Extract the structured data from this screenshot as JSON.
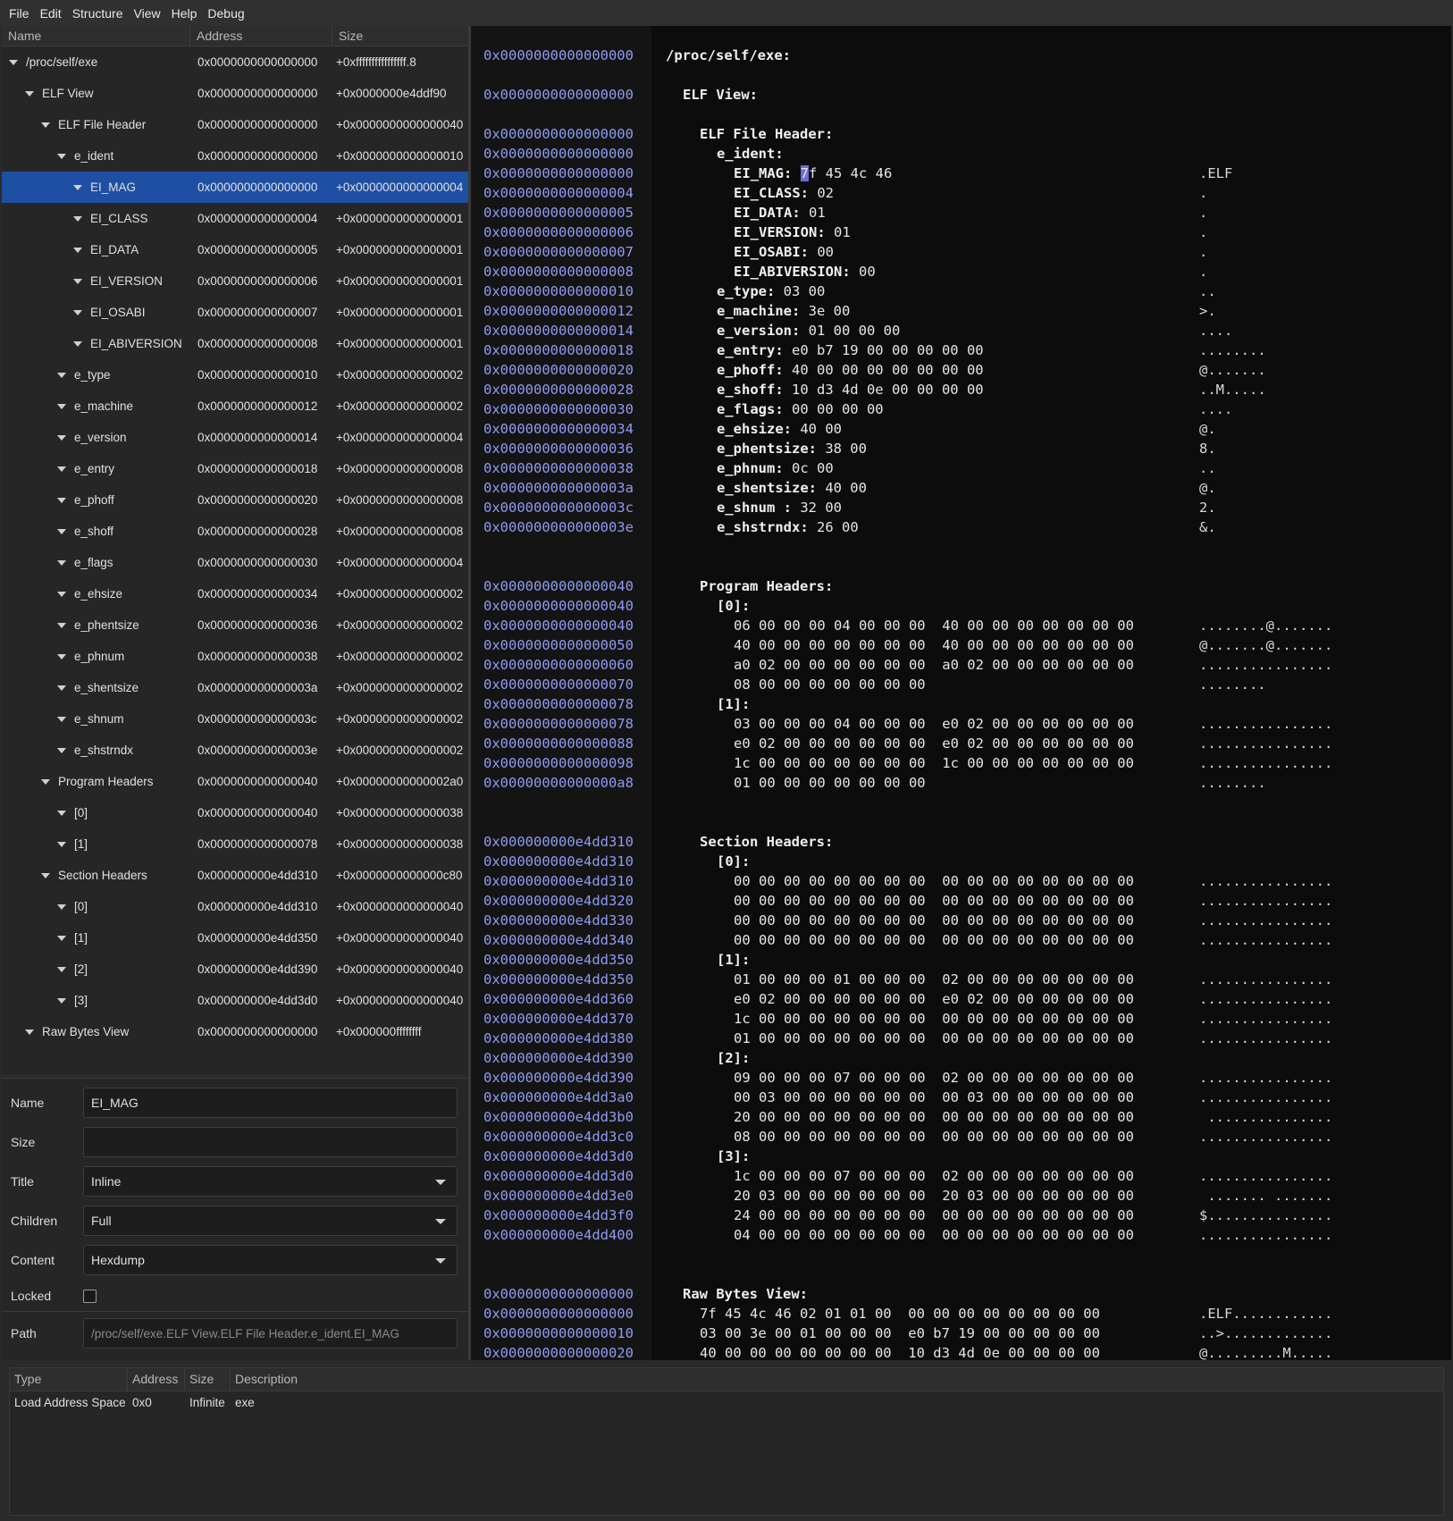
{
  "menu": [
    "File",
    "Edit",
    "Structure",
    "View",
    "Help",
    "Debug"
  ],
  "tree": {
    "columns": [
      "Name",
      "Address",
      "Size"
    ],
    "rows": [
      {
        "name": "/proc/self/exe",
        "addr": "0x0000000000000000",
        "size": "+0xffffffffffffffff.8",
        "level": 0
      },
      {
        "name": "ELF View",
        "addr": "0x0000000000000000",
        "size": "+0x0000000e4ddf90",
        "level": 1
      },
      {
        "name": "ELF File Header",
        "addr": "0x0000000000000000",
        "size": "+0x0000000000000040",
        "level": 2
      },
      {
        "name": "e_ident",
        "addr": "0x0000000000000000",
        "size": "+0x0000000000000010",
        "level": 3
      },
      {
        "name": "EI_MAG",
        "addr": "0x0000000000000000",
        "size": "+0x0000000000000004",
        "level": 4,
        "selected": true
      },
      {
        "name": "EI_CLASS",
        "addr": "0x0000000000000004",
        "size": "+0x0000000000000001",
        "level": 4
      },
      {
        "name": "EI_DATA",
        "addr": "0x0000000000000005",
        "size": "+0x0000000000000001",
        "level": 4
      },
      {
        "name": "EI_VERSION",
        "addr": "0x0000000000000006",
        "size": "+0x0000000000000001",
        "level": 4
      },
      {
        "name": "EI_OSABI",
        "addr": "0x0000000000000007",
        "size": "+0x0000000000000001",
        "level": 4
      },
      {
        "name": "EI_ABIVERSION",
        "addr": "0x0000000000000008",
        "size": "+0x0000000000000001",
        "level": 4
      },
      {
        "name": "e_type",
        "addr": "0x0000000000000010",
        "size": "+0x0000000000000002",
        "level": 3
      },
      {
        "name": "e_machine",
        "addr": "0x0000000000000012",
        "size": "+0x0000000000000002",
        "level": 3
      },
      {
        "name": "e_version",
        "addr": "0x0000000000000014",
        "size": "+0x0000000000000004",
        "level": 3
      },
      {
        "name": "e_entry",
        "addr": "0x0000000000000018",
        "size": "+0x0000000000000008",
        "level": 3
      },
      {
        "name": "e_phoff",
        "addr": "0x0000000000000020",
        "size": "+0x0000000000000008",
        "level": 3
      },
      {
        "name": "e_shoff",
        "addr": "0x0000000000000028",
        "size": "+0x0000000000000008",
        "level": 3
      },
      {
        "name": "e_flags",
        "addr": "0x0000000000000030",
        "size": "+0x0000000000000004",
        "level": 3
      },
      {
        "name": "e_ehsize",
        "addr": "0x0000000000000034",
        "size": "+0x0000000000000002",
        "level": 3
      },
      {
        "name": "e_phentsize",
        "addr": "0x0000000000000036",
        "size": "+0x0000000000000002",
        "level": 3
      },
      {
        "name": "e_phnum",
        "addr": "0x0000000000000038",
        "size": "+0x0000000000000002",
        "level": 3
      },
      {
        "name": "e_shentsize",
        "addr": "0x000000000000003a",
        "size": "+0x0000000000000002",
        "level": 3
      },
      {
        "name": "e_shnum",
        "addr": "0x000000000000003c",
        "size": "+0x0000000000000002",
        "level": 3
      },
      {
        "name": "e_shstrndx",
        "addr": "0x000000000000003e",
        "size": "+0x0000000000000002",
        "level": 3
      },
      {
        "name": "Program Headers",
        "addr": "0x0000000000000040",
        "size": "+0x00000000000002a0",
        "level": 2
      },
      {
        "name": "[0]",
        "addr": "0x0000000000000040",
        "size": "+0x0000000000000038",
        "level": 3
      },
      {
        "name": "[1]",
        "addr": "0x0000000000000078",
        "size": "+0x0000000000000038",
        "level": 3
      },
      {
        "name": "Section Headers",
        "addr": "0x000000000e4dd310",
        "size": "+0x0000000000000c80",
        "level": 2
      },
      {
        "name": "[0]",
        "addr": "0x000000000e4dd310",
        "size": "+0x0000000000000040",
        "level": 3
      },
      {
        "name": "[1]",
        "addr": "0x000000000e4dd350",
        "size": "+0x0000000000000040",
        "level": 3
      },
      {
        "name": "[2]",
        "addr": "0x000000000e4dd390",
        "size": "+0x0000000000000040",
        "level": 3
      },
      {
        "name": "[3]",
        "addr": "0x000000000e4dd3d0",
        "size": "+0x0000000000000040",
        "level": 3
      },
      {
        "name": "Raw Bytes View",
        "addr": "0x0000000000000000",
        "size": "+0x000000ffffffff",
        "level": 1
      }
    ]
  },
  "props": {
    "name_label": "Name",
    "name_value": "EI_MAG",
    "size_label": "Size",
    "size_value": "",
    "title_label": "Title",
    "title_value": "Inline",
    "children_label": "Children",
    "children_value": "Full",
    "content_label": "Content",
    "content_value": "Hexdump",
    "locked_label": "Locked",
    "locked": false,
    "path_label": "Path",
    "path_value": "/proc/self/exe.ELF View.ELF File Header.e_ident.EI_MAG"
  },
  "hex": {
    "cursor_char": "7",
    "lines": [
      {
        "row": 0,
        "addr": "0x0000000000000000",
        "key": "/proc/self/exe:",
        "indent": 0
      },
      {
        "row": 2,
        "addr": "0x0000000000000000",
        "key": "ELF View:",
        "indent": 1
      },
      {
        "row": 4,
        "addr": "0x0000000000000000",
        "key": "ELF File Header:",
        "indent": 2
      },
      {
        "row": 5,
        "addr": "0x0000000000000000",
        "key": "e_ident:",
        "indent": 3
      },
      {
        "row": 6,
        "addr": "0x0000000000000000",
        "key": "EI_MAG:",
        "indent": 4,
        "val": "f 45 4c 46",
        "ascii": ".ELF",
        "cursor": true
      },
      {
        "row": 7,
        "addr": "0x0000000000000004",
        "key": "EI_CLASS:",
        "indent": 4,
        "val": " 02",
        "ascii": "."
      },
      {
        "row": 8,
        "addr": "0x0000000000000005",
        "key": "EI_DATA:",
        "indent": 4,
        "val": " 01",
        "ascii": "."
      },
      {
        "row": 9,
        "addr": "0x0000000000000006",
        "key": "EI_VERSION:",
        "indent": 4,
        "val": " 01",
        "ascii": "."
      },
      {
        "row": 10,
        "addr": "0x0000000000000007",
        "key": "EI_OSABI:",
        "indent": 4,
        "val": " 00",
        "ascii": "."
      },
      {
        "row": 11,
        "addr": "0x0000000000000008",
        "key": "EI_ABIVERSION:",
        "indent": 4,
        "val": " 00",
        "ascii": "."
      },
      {
        "row": 12,
        "addr": "0x0000000000000010",
        "key": "e_type:",
        "indent": 3,
        "val": " 03 00",
        "ascii": ".."
      },
      {
        "row": 13,
        "addr": "0x0000000000000012",
        "key": "e_machine:",
        "indent": 3,
        "val": " 3e 00",
        "ascii": ">."
      },
      {
        "row": 14,
        "addr": "0x0000000000000014",
        "key": "e_version:",
        "indent": 3,
        "val": " 01 00 00 00",
        "ascii": "...."
      },
      {
        "row": 15,
        "addr": "0x0000000000000018",
        "key": "e_entry:",
        "indent": 3,
        "val": " e0 b7 19 00 00 00 00 00",
        "ascii": "........"
      },
      {
        "row": 16,
        "addr": "0x0000000000000020",
        "key": "e_phoff:",
        "indent": 3,
        "val": " 40 00 00 00 00 00 00 00",
        "ascii": "@......."
      },
      {
        "row": 17,
        "addr": "0x0000000000000028",
        "key": "e_shoff:",
        "indent": 3,
        "val": " 10 d3 4d 0e 00 00 00 00",
        "ascii": "..M....."
      },
      {
        "row": 18,
        "addr": "0x0000000000000030",
        "key": "e_flags:",
        "indent": 3,
        "val": " 00 00 00 00",
        "ascii": "...."
      },
      {
        "row": 19,
        "addr": "0x0000000000000034",
        "key": "e_ehsize:",
        "indent": 3,
        "val": " 40 00",
        "ascii": "@."
      },
      {
        "row": 20,
        "addr": "0x0000000000000036",
        "key": "e_phentsize:",
        "indent": 3,
        "val": " 38 00",
        "ascii": "8."
      },
      {
        "row": 21,
        "addr": "0x0000000000000038",
        "key": "e_phnum:",
        "indent": 3,
        "val": " 0c 00",
        "ascii": ".."
      },
      {
        "row": 22,
        "addr": "0x000000000000003a",
        "key": "e_shentsize:",
        "indent": 3,
        "val": " 40 00",
        "ascii": "@."
      },
      {
        "row": 23,
        "addr": "0x000000000000003c",
        "key": "e_shnum :",
        "indent": 3,
        "val": " 32 00",
        "ascii": "2."
      },
      {
        "row": 24,
        "addr": "0x000000000000003e",
        "key": "e_shstrndx:",
        "indent": 3,
        "val": " 26 00",
        "ascii": "&."
      },
      {
        "row": 27,
        "addr": "0x0000000000000040",
        "key": "Program Headers:",
        "indent": 2
      },
      {
        "row": 28,
        "addr": "0x0000000000000040",
        "key": "[0]:",
        "indent": 3
      },
      {
        "row": 29,
        "addr": "0x0000000000000040",
        "indent": 4,
        "val": "06 00 00 00 04 00 00 00  40 00 00 00 00 00 00 00",
        "ascii": "........@......."
      },
      {
        "row": 30,
        "addr": "0x0000000000000050",
        "indent": 4,
        "val": "40 00 00 00 00 00 00 00  40 00 00 00 00 00 00 00",
        "ascii": "@.......@......."
      },
      {
        "row": 31,
        "addr": "0x0000000000000060",
        "indent": 4,
        "val": "a0 02 00 00 00 00 00 00  a0 02 00 00 00 00 00 00",
        "ascii": "................"
      },
      {
        "row": 32,
        "addr": "0x0000000000000070",
        "indent": 4,
        "val": "08 00 00 00 00 00 00 00",
        "ascii": "........"
      },
      {
        "row": 33,
        "addr": "0x0000000000000078",
        "key": "[1]:",
        "indent": 3
      },
      {
        "row": 34,
        "addr": "0x0000000000000078",
        "indent": 4,
        "val": "03 00 00 00 04 00 00 00  e0 02 00 00 00 00 00 00",
        "ascii": "................"
      },
      {
        "row": 35,
        "addr": "0x0000000000000088",
        "indent": 4,
        "val": "e0 02 00 00 00 00 00 00  e0 02 00 00 00 00 00 00",
        "ascii": "................"
      },
      {
        "row": 36,
        "addr": "0x0000000000000098",
        "indent": 4,
        "val": "1c 00 00 00 00 00 00 00  1c 00 00 00 00 00 00 00",
        "ascii": "................"
      },
      {
        "row": 37,
        "addr": "0x00000000000000a8",
        "indent": 4,
        "val": "01 00 00 00 00 00 00 00",
        "ascii": "........"
      },
      {
        "row": 40,
        "addr": "0x000000000e4dd310",
        "key": "Section Headers:",
        "indent": 2
      },
      {
        "row": 41,
        "addr": "0x000000000e4dd310",
        "key": "[0]:",
        "indent": 3
      },
      {
        "row": 42,
        "addr": "0x000000000e4dd310",
        "indent": 4,
        "val": "00 00 00 00 00 00 00 00  00 00 00 00 00 00 00 00",
        "ascii": "................"
      },
      {
        "row": 43,
        "addr": "0x000000000e4dd320",
        "indent": 4,
        "val": "00 00 00 00 00 00 00 00  00 00 00 00 00 00 00 00",
        "ascii": "................"
      },
      {
        "row": 44,
        "addr": "0x000000000e4dd330",
        "indent": 4,
        "val": "00 00 00 00 00 00 00 00  00 00 00 00 00 00 00 00",
        "ascii": "................"
      },
      {
        "row": 45,
        "addr": "0x000000000e4dd340",
        "indent": 4,
        "val": "00 00 00 00 00 00 00 00  00 00 00 00 00 00 00 00",
        "ascii": "................"
      },
      {
        "row": 46,
        "addr": "0x000000000e4dd350",
        "key": "[1]:",
        "indent": 3
      },
      {
        "row": 47,
        "addr": "0x000000000e4dd350",
        "indent": 4,
        "val": "01 00 00 00 01 00 00 00  02 00 00 00 00 00 00 00",
        "ascii": "................"
      },
      {
        "row": 48,
        "addr": "0x000000000e4dd360",
        "indent": 4,
        "val": "e0 02 00 00 00 00 00 00  e0 02 00 00 00 00 00 00",
        "ascii": "................"
      },
      {
        "row": 49,
        "addr": "0x000000000e4dd370",
        "indent": 4,
        "val": "1c 00 00 00 00 00 00 00  00 00 00 00 00 00 00 00",
        "ascii": "................"
      },
      {
        "row": 50,
        "addr": "0x000000000e4dd380",
        "indent": 4,
        "val": "01 00 00 00 00 00 00 00  00 00 00 00 00 00 00 00",
        "ascii": "................"
      },
      {
        "row": 51,
        "addr": "0x000000000e4dd390",
        "key": "[2]:",
        "indent": 3
      },
      {
        "row": 52,
        "addr": "0x000000000e4dd390",
        "indent": 4,
        "val": "09 00 00 00 07 00 00 00  02 00 00 00 00 00 00 00",
        "ascii": "................"
      },
      {
        "row": 53,
        "addr": "0x000000000e4dd3a0",
        "indent": 4,
        "val": "00 03 00 00 00 00 00 00  00 03 00 00 00 00 00 00",
        "ascii": "................"
      },
      {
        "row": 54,
        "addr": "0x000000000e4dd3b0",
        "indent": 4,
        "val": "20 00 00 00 00 00 00 00  00 00 00 00 00 00 00 00",
        "ascii": " ..............."
      },
      {
        "row": 55,
        "addr": "0x000000000e4dd3c0",
        "indent": 4,
        "val": "08 00 00 00 00 00 00 00  00 00 00 00 00 00 00 00",
        "ascii": "................"
      },
      {
        "row": 56,
        "addr": "0x000000000e4dd3d0",
        "key": "[3]:",
        "indent": 3
      },
      {
        "row": 57,
        "addr": "0x000000000e4dd3d0",
        "indent": 4,
        "val": "1c 00 00 00 07 00 00 00  02 00 00 00 00 00 00 00",
        "ascii": "................"
      },
      {
        "row": 58,
        "addr": "0x000000000e4dd3e0",
        "indent": 4,
        "val": "20 03 00 00 00 00 00 00  20 03 00 00 00 00 00 00",
        "ascii": " ....... ......."
      },
      {
        "row": 59,
        "addr": "0x000000000e4dd3f0",
        "indent": 4,
        "val": "24 00 00 00 00 00 00 00  00 00 00 00 00 00 00 00",
        "ascii": "$..............."
      },
      {
        "row": 60,
        "addr": "0x000000000e4dd400",
        "indent": 4,
        "val": "04 00 00 00 00 00 00 00  00 00 00 00 00 00 00 00",
        "ascii": "................"
      },
      {
        "row": 63,
        "addr": "0x0000000000000000",
        "key": "Raw Bytes View:",
        "indent": 1
      },
      {
        "row": 64,
        "addr": "0x0000000000000000",
        "indent": 2,
        "val": "7f 45 4c 46 02 01 01 00  00 00 00 00 00 00 00 00",
        "ascii": ".ELF............"
      },
      {
        "row": 65,
        "addr": "0x0000000000000010",
        "indent": 2,
        "val": "03 00 3e 00 01 00 00 00  e0 b7 19 00 00 00 00 00",
        "ascii": "..>............."
      },
      {
        "row": 66,
        "addr": "0x0000000000000020",
        "indent": 2,
        "val": "40 00 00 00 00 00 00 00  10 d3 4d 0e 00 00 00 00",
        "ascii": "@.........M....."
      }
    ]
  },
  "bottom": {
    "columns": [
      "Type",
      "Address",
      "Size",
      "Description"
    ],
    "rows": [
      {
        "type": "Load Address Space",
        "address": "0x0",
        "size": "Infinite",
        "description": "exe"
      }
    ]
  }
}
